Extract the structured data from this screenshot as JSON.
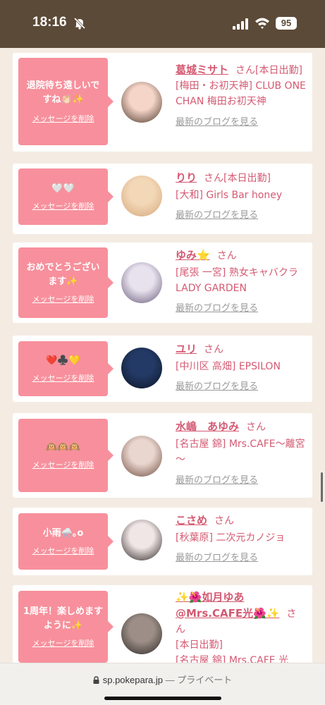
{
  "status": {
    "time": "18:16",
    "battery": "95"
  },
  "browser": {
    "url": "sp.pokepara.jp",
    "separator": " — ",
    "mode": "プライベート"
  },
  "common": {
    "delete_label": "メッセージを削除",
    "san": "さん",
    "blog_label": "最新のブログを見る"
  },
  "cards": [
    {
      "message": "退院待ち遠しいですね👏🏻✨",
      "name": "葛城ミサト",
      "details": [
        "[本日出勤]",
        "[梅田・お初天神] CLUB ONE CHAN 梅田お初天神"
      ],
      "avatar_colors": [
        "#f4d5c8",
        "#4b3528"
      ]
    },
    {
      "message": "🤍🤍",
      "name": "りり",
      "details": [
        "[本日出勤]",
        "[大和] Girls Bar honey"
      ],
      "avatar_colors": [
        "#f3d8b8",
        "#d4a77a"
      ]
    },
    {
      "message": "おめでとうございます✨",
      "name": "ゆみ⭐️",
      "details": [
        "[尾張 一宮] 熟女キャバクラ LADY GARDEN"
      ],
      "avatar_colors": [
        "#e8e2ee",
        "#6a5a7a"
      ]
    },
    {
      "message": "❤️♣️💛",
      "name": "ユリ",
      "details": [
        "[中川区 高畑] EPSILON"
      ],
      "avatar_colors": [
        "#233a66",
        "#0d1424"
      ]
    },
    {
      "message": "🙉🙉🙉",
      "name": "水嶋　あゆみ",
      "details": [
        "[名古屋 錦] Mrs.CAFE～離宮～"
      ],
      "avatar_colors": [
        "#e9d6cf",
        "#6e4b3d"
      ]
    },
    {
      "message": "小雨🌧️｡o",
      "name": "こさめ",
      "details": [
        "[秋葉原] 二次元カノジョ"
      ],
      "avatar_colors": [
        "#f1e6e6",
        "#2b2323"
      ]
    },
    {
      "message": "1周年！楽しめますように✨",
      "name": "✨🌺如月ゆあ@Mrs.CAFE光🌺✨",
      "details": [
        "[本日出勤]",
        "[名古屋 錦] Mrs.CAFE 光"
      ],
      "avatar_colors": [
        "#9d8f88",
        "#2e2724"
      ]
    }
  ]
}
